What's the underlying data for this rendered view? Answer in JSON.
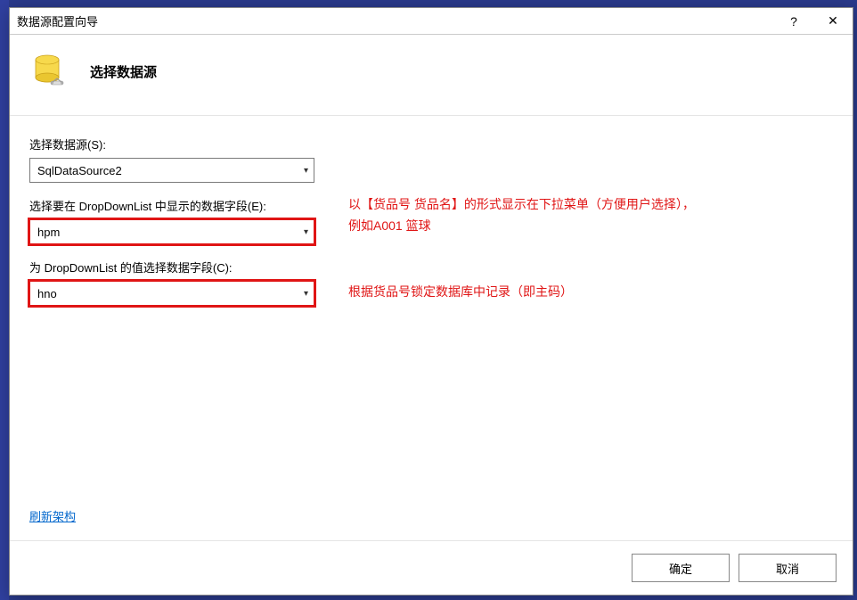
{
  "titlebar": {
    "title": "数据源配置向导",
    "help_symbol": "?",
    "close_symbol": "✕"
  },
  "header": {
    "title": "选择数据源"
  },
  "fields": {
    "datasource": {
      "label": "选择数据源(S):",
      "value": "SqlDataSource2"
    },
    "display_field": {
      "label": "选择要在 DropDownList 中显示的数据字段(E):",
      "value": "hpm"
    },
    "value_field": {
      "label": "为 DropDownList 的值选择数据字段(C):",
      "value": "hno"
    }
  },
  "annotations": {
    "display_note": "以【货品号 货品名】的形式显示在下拉菜单（方便用户选择），\n例如A001 篮球",
    "value_note": "根据货品号锁定数据库中记录（即主码）"
  },
  "links": {
    "refresh": "刷新架构"
  },
  "footer": {
    "ok": "确定",
    "cancel": "取消"
  }
}
